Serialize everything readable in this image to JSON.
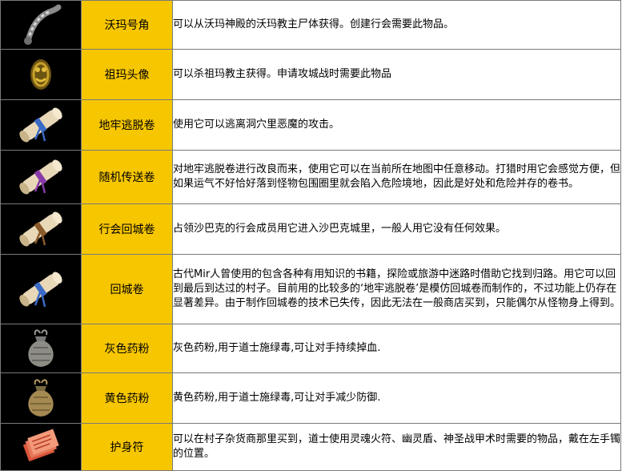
{
  "items": [
    {
      "name": "沃玛号角",
      "desc": "可以从沃玛神殿的沃玛教主尸体获得。创建行会需要此物品。",
      "icon": "horn-icon",
      "h": 60
    },
    {
      "name": "祖玛头像",
      "desc": "可以杀祖玛教主获得。申请攻城战时需要此物品",
      "icon": "zuma-idol-icon",
      "h": 62
    },
    {
      "name": "地牢逃脱卷",
      "desc": "使用它可以逃离洞穴里恶魔的攻击。",
      "icon": "scroll-icon-blue",
      "h": 62
    },
    {
      "name": "随机传送卷",
      "desc": "对地牢逃脱卷进行改良而来，使用它可以在当前所在地图中任意移动。打猎时用它会感觉方便，但如果运气不好恰好落到怪物包围圈里就会陷入危险境地，因此是好处和危险并存的卷书。",
      "icon": "scroll-icon-purple",
      "h": 66
    },
    {
      "name": "行会回城卷",
      "desc": "占领沙巴克的行会成员用它进入沙巴克城里，一般人用它没有任何效果。",
      "icon": "scroll-icon-brown",
      "h": 62
    },
    {
      "name": "回城卷",
      "desc": "古代Mir人曾使用的包含各种有用知识的书籍，探险或旅游中迷路时借助它找到归路。用它可以回到最后到达过的村子。目前用的比较多的‘地牢逃脱卷’是模仿回城卷而制作的，不过功能上仍存在显著差异。由于制作回城卷的技术已失传，因此无法在一般商店买到，只能偶尔从怪物身上得到。",
      "icon": "scroll-icon-blue-2",
      "h": 86
    },
    {
      "name": "灰色药粉",
      "desc": "灰色药粉,用于道士施绿毒,可让对手持续掉血.",
      "icon": "grey-powder-bag-icon",
      "h": 60
    },
    {
      "name": "黄色药粉",
      "desc": "黄色药粉,用于道士施绿毒,可让对手减少防御.",
      "icon": "yellow-powder-bag-icon",
      "h": 62
    },
    {
      "name": "护身符",
      "desc": "可以在村子杂货商那里买到，道士使用灵魂火符、幽灵盾、神圣战甲术时需要的物品，戴在左手镯的位置。",
      "icon": "amulet-icon",
      "h": 58
    }
  ]
}
